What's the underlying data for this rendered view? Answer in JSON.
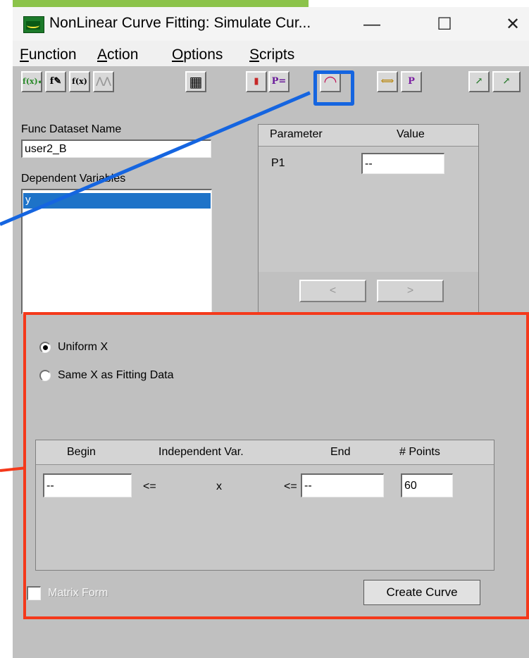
{
  "window": {
    "title": "NonLinear Curve Fitting: Simulate Cur...",
    "controls": {
      "minimize": "—",
      "maximize": "☐",
      "close": "✕"
    }
  },
  "menu": {
    "items": [
      {
        "accel": "F",
        "rest": "unction"
      },
      {
        "accel": "A",
        "rest": "ction"
      },
      {
        "accel": "O",
        "rest": "ptions"
      },
      {
        "accel": "S",
        "rest": "cripts"
      }
    ]
  },
  "toolbar": {
    "buttons": [
      {
        "name": "function-check-icon",
        "glyph": "f(x)✔"
      },
      {
        "name": "function-edit-icon",
        "glyph": "f✎"
      },
      {
        "name": "function-library-icon",
        "glyph": "f(x)"
      },
      {
        "name": "peak-icon",
        "glyph": "⋀⋀"
      },
      {
        "name": "worksheet-icon",
        "glyph": "▦"
      },
      {
        "name": "traffic-light-icon",
        "glyph": "▮"
      },
      {
        "name": "parameters-icon",
        "glyph": "P="
      },
      {
        "name": "simulate-curve-icon",
        "glyph": "◠"
      },
      {
        "name": "dataset-range-icon",
        "glyph": "⟺"
      },
      {
        "name": "parameter-confidence-icon",
        "glyph": "P"
      },
      {
        "name": "one-iteration-icon",
        "glyph": "↗"
      },
      {
        "name": "more-iterations-icon",
        "glyph": "↗"
      }
    ],
    "highlight_color": "#1565e0"
  },
  "func_dataset": {
    "label": "Func Dataset Name",
    "value": "user2_B"
  },
  "dependent_vars": {
    "label": "Dependent Variables",
    "items": [
      "y"
    ]
  },
  "parameters": {
    "header_param": "Parameter",
    "header_value": "Value",
    "rows": [
      {
        "name": "P1",
        "value": "--"
      }
    ],
    "prev": "<",
    "next": ">"
  },
  "simulate": {
    "radio_uniform": "Uniform X",
    "radio_same": "Same X as Fitting Data",
    "selected": "Uniform X",
    "range_headers": {
      "begin": "Begin",
      "indep": "Independent Var.",
      "end": "End",
      "points": "# Points"
    },
    "begin_value": "--",
    "le1": "<=",
    "indep_var": "x",
    "le2": "<=",
    "end_value": "--",
    "points_value": "60",
    "matrix_form": "Matrix Form",
    "create_curve": "Create Curve",
    "annotation_color": "#f4391b"
  }
}
